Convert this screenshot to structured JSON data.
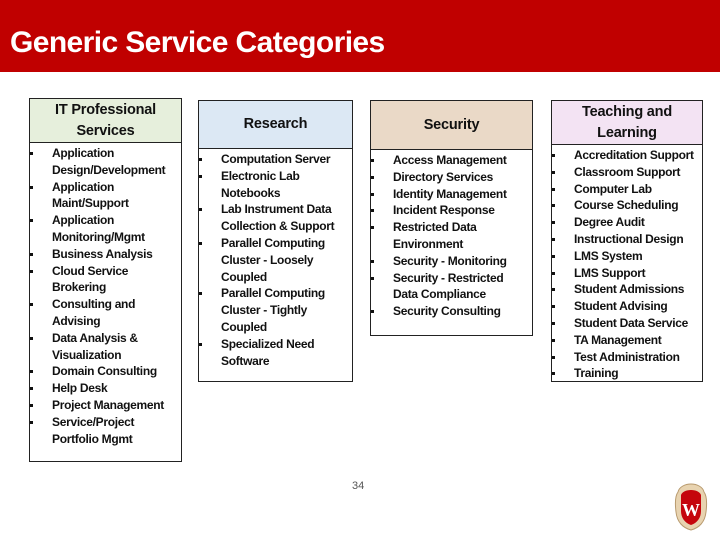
{
  "slide": {
    "title": "Generic Service Categories",
    "page_number": "34",
    "colors": {
      "title_band": "#c00000",
      "it_header": "#e6efdc",
      "research_header": "#dce8f4",
      "security_header": "#ead9c7",
      "teaching_header": "#f3e3f3"
    }
  },
  "categories": {
    "it": {
      "title": "IT Professional Services",
      "items": [
        "Application Design/Development",
        "Application Maint/Support",
        "Application Monitoring/Mgmt",
        "Business Analysis",
        "Cloud Service Brokering",
        "Consulting and Advising",
        "Data Analysis & Visualization",
        "Domain Consulting",
        "Help Desk",
        "Project Management",
        "Service/Project Portfolio Mgmt"
      ]
    },
    "research": {
      "title": "Research",
      "items": [
        "Computation Server",
        "Electronic Lab Notebooks",
        "Lab Instrument Data Collection & Support",
        "Parallel Computing Cluster - Loosely Coupled",
        "Parallel Computing Cluster - Tightly Coupled",
        "Specialized Need Software"
      ]
    },
    "security": {
      "title": "Security",
      "items": [
        "Access Management",
        "Directory Services",
        "Identity Management",
        "Incident Response",
        "Restricted Data Environment",
        "Security - Monitoring",
        "Security - Restricted Data Compliance",
        "Security Consulting"
      ]
    },
    "teaching": {
      "title": "Teaching and Learning",
      "items": [
        "Accreditation Support",
        "Classroom Support",
        "Computer Lab",
        "Course Scheduling",
        "Degree Audit",
        "Instructional Design",
        "LMS System",
        "LMS Support",
        "Student Admissions",
        "Student Advising",
        "Student Data Service",
        "TA Management",
        "Test Administration",
        "Training"
      ]
    }
  },
  "logo": {
    "icon": "university-crest-icon",
    "letter": "W"
  }
}
